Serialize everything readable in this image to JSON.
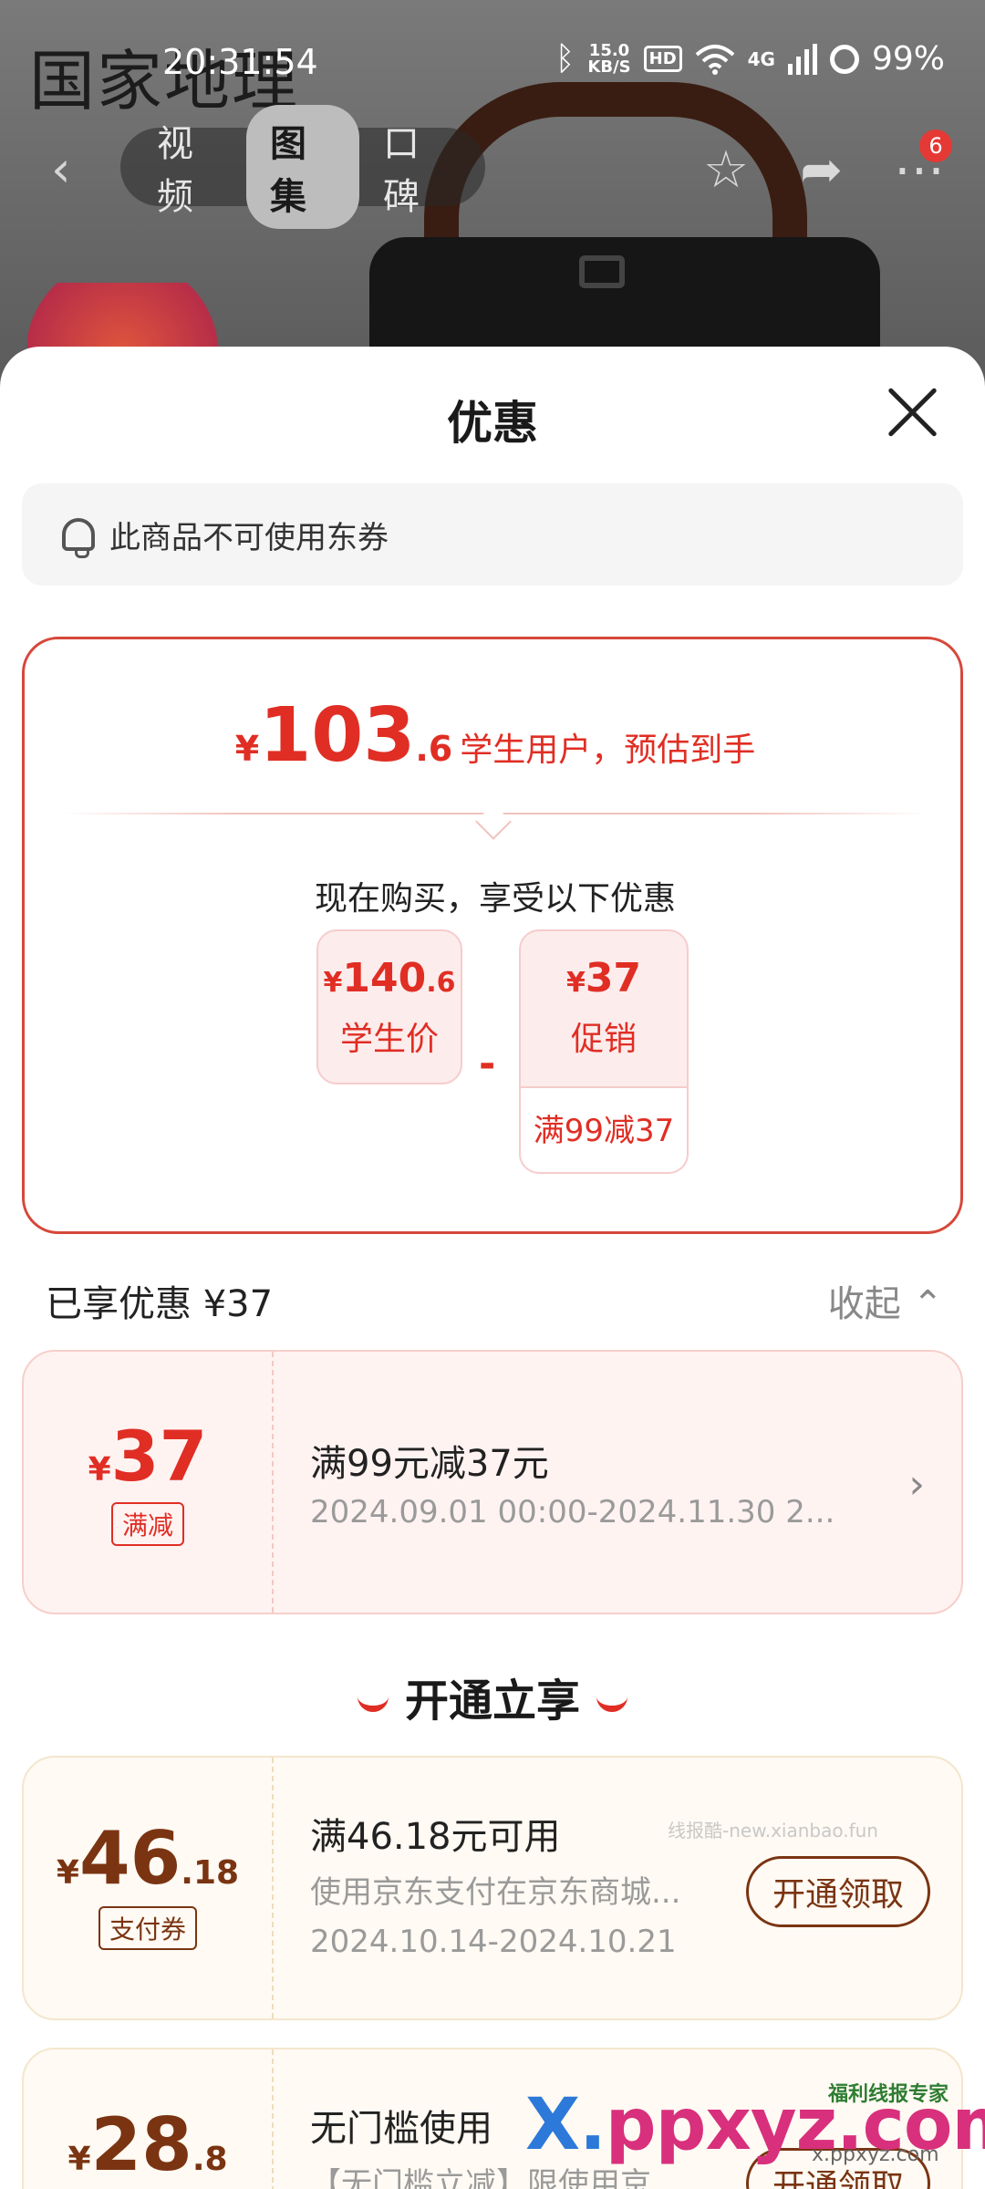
{
  "background": {
    "brand_watermark": "国家地理"
  },
  "status_bar": {
    "time": "20:31:54",
    "net_speed_top": "15.0",
    "net_speed_unit": "KB/S",
    "hd": "HD",
    "network": "4G",
    "battery": "99%"
  },
  "nav": {
    "back_icon": "‹",
    "tabs": [
      {
        "label": "视频"
      },
      {
        "label": "图集"
      },
      {
        "label": "口碑"
      }
    ],
    "star_icon": "☆",
    "share_icon": "➦",
    "more_icon": "⋯",
    "message_count": "6"
  },
  "sheet": {
    "title": "优惠",
    "notice": "此商品不可使用东券",
    "estimate": {
      "yen": "¥",
      "integer": "103",
      "decimal": ".6",
      "text": "学生用户，预估到手"
    },
    "buy_now": "现在购买，享受以下优惠",
    "chips": [
      {
        "yen": "¥",
        "price": "140",
        "decimal": ".6",
        "label": "学生价"
      },
      {
        "yen": "¥",
        "price": "37",
        "decimal": "",
        "label": "促销",
        "foot": "满99减37"
      }
    ],
    "minus": "-",
    "enjoyed": "已享优惠 ¥37",
    "collapse": "收起 ⌃",
    "applied_coupon": {
      "yen": "¥",
      "amount": "37",
      "tag": "满减",
      "title": "满99元减37元",
      "period": "2024.09.01 00:00-2024.11.30 2..."
    },
    "open_title": "开通立享",
    "offers": [
      {
        "yen": "¥",
        "amount": "46",
        "decimal": ".18",
        "tag": "支付券",
        "title": "满46.18元可用",
        "desc": "使用京东支付在京东商城...",
        "period": "2024.10.14-2024.10.21",
        "button": "开通领取"
      },
      {
        "yen": "¥",
        "amount": "28",
        "decimal": ".8",
        "title": "无门槛使用",
        "desc": "【无门槛立减】限使用京...",
        "button": "开通领取"
      }
    ]
  },
  "watermarks": {
    "small": "线报酷-new.xianbao.fun",
    "big_prefix": "X.",
    "big_rest": "ppxyz.com",
    "badge": "福利线报专家",
    "domain": "x.ppxyz.com"
  },
  "colors": {
    "accent_red": "#e02e24",
    "brown": "#7a3412"
  }
}
